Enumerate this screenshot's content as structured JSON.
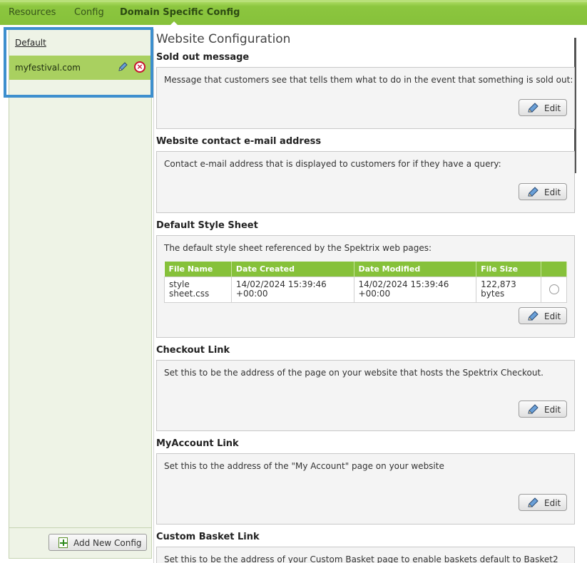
{
  "nav": {
    "tabs": [
      "Resources",
      "Config",
      "Domain Specific Config"
    ],
    "active_tab": "Domain Specific Config"
  },
  "sidebar": {
    "default_link": "Default",
    "selected_item": "myfestival.com",
    "add_button": "Add New Config"
  },
  "main": {
    "page_title": "Website Configuration",
    "edit_label": "Edit",
    "sections": {
      "sold_out": {
        "title": "Sold out message",
        "desc": "Message that customers see that tells them what to do in the event that something is sold out:"
      },
      "contact": {
        "title": "Website contact e-mail address",
        "desc": "Contact e-mail address that is displayed to customers for if they have a query:"
      },
      "stylesheet": {
        "title": "Default Style Sheet",
        "desc": "The default style sheet referenced by the Spektrix web pages:",
        "columns": [
          "File Name",
          "Date Created",
          "Date Modified",
          "File Size",
          ""
        ],
        "rows": [
          {
            "file_name": "style sheet.css",
            "date_created": "14/02/2024 15:39:46 +00:00",
            "date_modified": "14/02/2024 15:39:46 +00:00",
            "file_size": "122,873 bytes"
          }
        ]
      },
      "checkout": {
        "title": "Checkout Link",
        "desc": "Set this to be the address of the page on your website that hosts the Spektrix Checkout."
      },
      "myaccount": {
        "title": "MyAccount Link",
        "desc": "Set this to the address of the \"My Account\" page on your website"
      },
      "basket": {
        "title": "Custom Basket Link",
        "desc": "Set this to be the address of your Custom Basket page to enable baskets default to Basket2"
      }
    }
  },
  "colors": {
    "nav_green": "#8cc63f",
    "selected_green": "#a9d060",
    "highlight_blue": "#3d8fce",
    "table_header": "#86c13a"
  },
  "icons": [
    "pencil-icon",
    "delete-icon",
    "add-config-icon"
  ]
}
